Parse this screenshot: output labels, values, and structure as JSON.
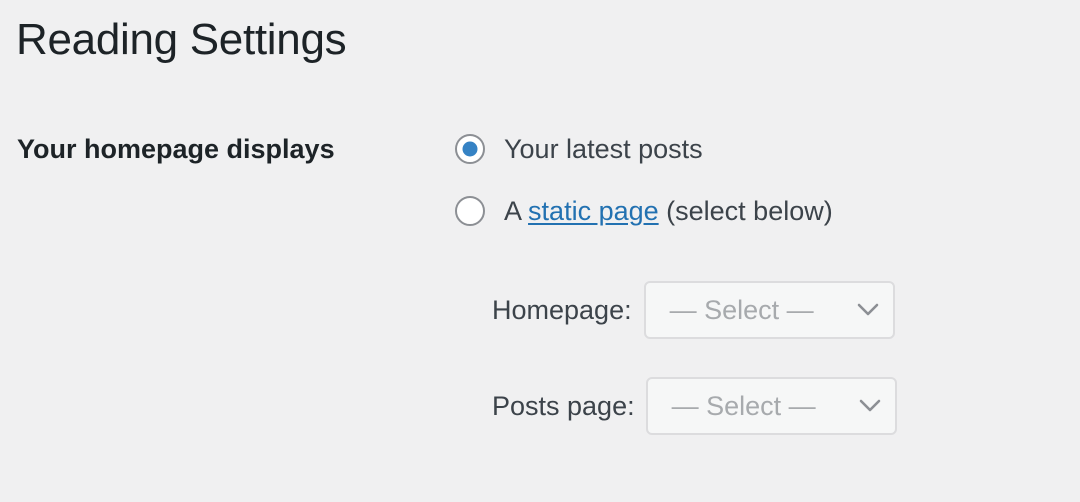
{
  "page_title": "Reading Settings",
  "homepage_displays": {
    "label": "Your homepage displays",
    "options": [
      {
        "label": "Your latest posts",
        "checked": true
      },
      {
        "prefix": "A",
        "link": "static page",
        "suffix": "(select below)",
        "checked": false
      }
    ]
  },
  "fields": {
    "homepage": {
      "label": "Homepage:",
      "value": "— Select —",
      "icon": "chevron-down-icon"
    },
    "posts_page": {
      "label": "Posts page:",
      "value": "— Select —",
      "icon": "chevron-down-icon"
    }
  },
  "colors": {
    "background": "#f0f0f1",
    "accent": "#3582c4",
    "link": "#2271b1"
  }
}
